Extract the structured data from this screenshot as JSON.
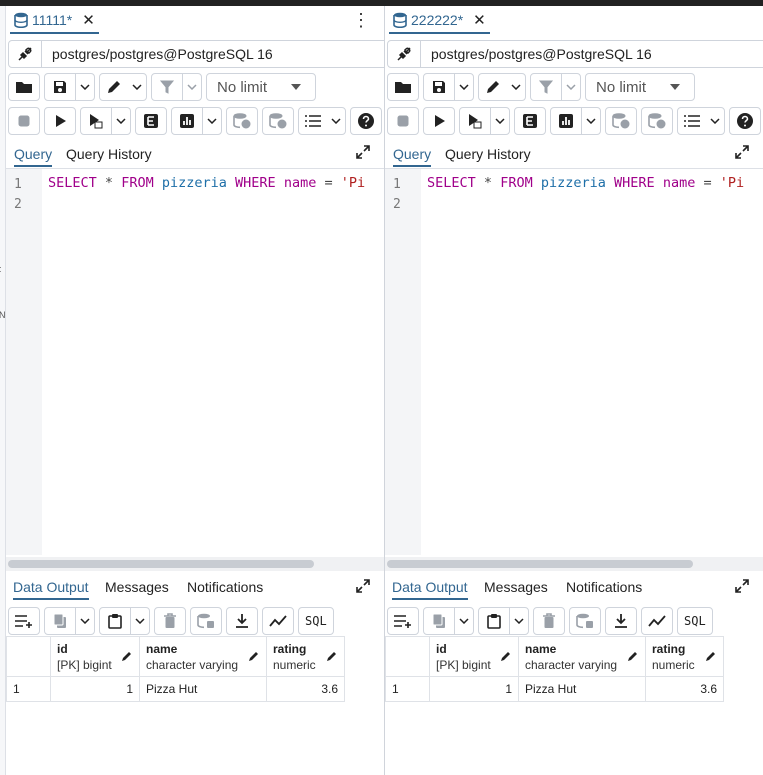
{
  "panels": [
    {
      "tab_title": "11111*",
      "connection": "postgres/postgres@PostgreSQL 16",
      "limit": "No limit",
      "query_tabs": [
        "Query",
        "Query History"
      ],
      "line_numbers": [
        "1",
        "2"
      ],
      "code": {
        "kw1": "SELECT",
        "star": "*",
        "kw2": "FROM",
        "table": "pizzeria",
        "kw3": "WHERE",
        "col": "name",
        "eq": "=",
        "str": "'Pi"
      },
      "output_tabs": [
        "Data Output",
        "Messages",
        "Notifications"
      ],
      "sql_label": "SQL",
      "columns": [
        {
          "name": "id",
          "type": "[PK] bigint"
        },
        {
          "name": "name",
          "type": "character varying"
        },
        {
          "name": "rating",
          "type": "numeric"
        }
      ],
      "rows": [
        {
          "row_num": "1",
          "id": "1",
          "name": "Pizza Hut",
          "rating": "3.6"
        }
      ]
    },
    {
      "tab_title": "222222*",
      "connection": "postgres/postgres@PostgreSQL 16",
      "limit": "No limit",
      "query_tabs": [
        "Query",
        "Query History"
      ],
      "line_numbers": [
        "1",
        "2"
      ],
      "code": {
        "kw1": "SELECT",
        "star": "*",
        "kw2": "FROM",
        "table": "pizzeria",
        "kw3": "WHERE",
        "col": "name",
        "eq": "=",
        "str": "'Pi"
      },
      "output_tabs": [
        "Data Output",
        "Messages",
        "Notifications"
      ],
      "sql_label": "SQL",
      "columns": [
        {
          "name": "id",
          "type": "[PK] bigint"
        },
        {
          "name": "name",
          "type": "character varying"
        },
        {
          "name": "rating",
          "type": "numeric"
        }
      ],
      "rows": [
        {
          "row_num": "1",
          "id": "1",
          "name": "Pizza Hut",
          "rating": "3.6"
        }
      ]
    }
  ],
  "colors": {
    "accent": "#326690",
    "keyword": "#a0008a",
    "identifier": "#1e6fa8",
    "string": "#b02020"
  },
  "icons": [
    "database-icon",
    "close-icon",
    "kebab-menu-icon",
    "plug-icon",
    "folder-icon",
    "save-icon",
    "pencil-icon",
    "filter-icon",
    "stop-icon",
    "play-icon",
    "explain-icon",
    "chart-icon",
    "commit-icon",
    "rollback-icon",
    "macros-icon",
    "help-icon",
    "expand-icon",
    "add-row-icon",
    "copy-icon",
    "paste-icon",
    "trash-icon",
    "save-data-icon",
    "download-icon",
    "graph-icon"
  ]
}
